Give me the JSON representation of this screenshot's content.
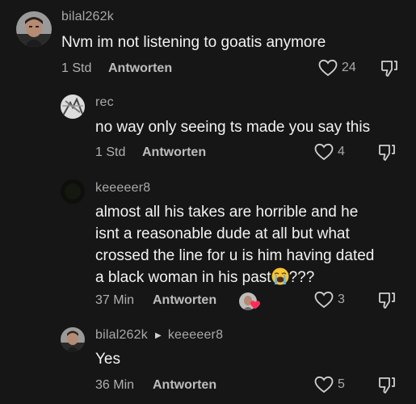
{
  "comments": [
    {
      "username": "bilal262k",
      "text": "Nvm im not listening to goatis anymore",
      "time": "1 Std",
      "reply_label": "Antworten",
      "likes": "24"
    },
    {
      "username": "rec",
      "text": "no way only seeing ts made you say this",
      "time": "1 Std",
      "reply_label": "Antworten",
      "likes": "4"
    },
    {
      "username": "keeeeer8",
      "text_before_emoji": "almost all his takes are horrible and he\nisnt a reasonable dude at all but what\ncrossed the line for u is him having dated\na black woman in his past",
      "emoji_icon": "loudly-crying-face",
      "text_after_emoji": "???",
      "time": "37 Min",
      "reply_label": "Antworten",
      "likes": "3",
      "creator_liked": true
    },
    {
      "username": "bilal262k",
      "reply_to": "keeeeer8",
      "text": "Yes",
      "time": "36 Min",
      "reply_label": "Antworten",
      "likes": "5"
    }
  ],
  "colors": {
    "background": "#161616",
    "text": "#f3f3f3",
    "muted": "#a9a9a9",
    "heart_badge": "#fe2c55"
  }
}
